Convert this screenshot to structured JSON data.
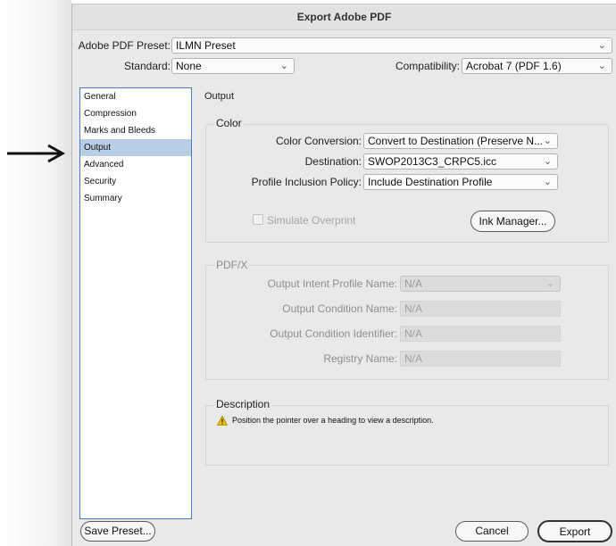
{
  "window": {
    "title": "Export Adobe PDF"
  },
  "preset": {
    "label": "Adobe PDF Preset:",
    "value": "ILMN Preset"
  },
  "standard": {
    "label": "Standard:",
    "value": "None"
  },
  "compatibility": {
    "label": "Compatibility:",
    "value": "Acrobat 7 (PDF 1.6)"
  },
  "sidebar": {
    "items": [
      {
        "label": "General"
      },
      {
        "label": "Compression"
      },
      {
        "label": "Marks and Bleeds"
      },
      {
        "label": "Output"
      },
      {
        "label": "Advanced"
      },
      {
        "label": "Security"
      },
      {
        "label": "Summary"
      }
    ],
    "selected": "Output"
  },
  "panel": {
    "title": "Output"
  },
  "color_group": {
    "title": "Color",
    "conversion": {
      "label": "Color Conversion:",
      "value": "Convert to Destination (Preserve N..."
    },
    "destination": {
      "label": "Destination:",
      "value": "SWOP2013C3_CRPC5.icc"
    },
    "profile_policy": {
      "label": "Profile Inclusion Policy:",
      "value": "Include Destination Profile"
    },
    "simulate_overprint": {
      "label": "Simulate Overprint"
    },
    "ink_manager": {
      "label": "Ink Manager..."
    }
  },
  "pdfx_group": {
    "title": "PDF/X",
    "intent_profile": {
      "label": "Output Intent Profile Name:",
      "value": "N/A"
    },
    "condition_name": {
      "label": "Output Condition Name:",
      "value": "N/A"
    },
    "condition_id": {
      "label": "Output Condition Identifier:",
      "value": "N/A"
    },
    "registry": {
      "label": "Registry Name:",
      "value": "N/A"
    }
  },
  "description_group": {
    "title": "Description",
    "text": "Position the pointer over a heading to view a description."
  },
  "buttons": {
    "save_preset": "Save Preset...",
    "cancel": "Cancel",
    "export": "Export"
  },
  "icons": {
    "arrow": "right-arrow-icon",
    "warning": "warning-icon",
    "chevron": "chevron-down-icon"
  },
  "colors": {
    "selection": "#b9cde6",
    "sidebar_border": "#4a7fc4",
    "dialog_bg": "#e9e9e9",
    "warning": "#f2c200"
  }
}
